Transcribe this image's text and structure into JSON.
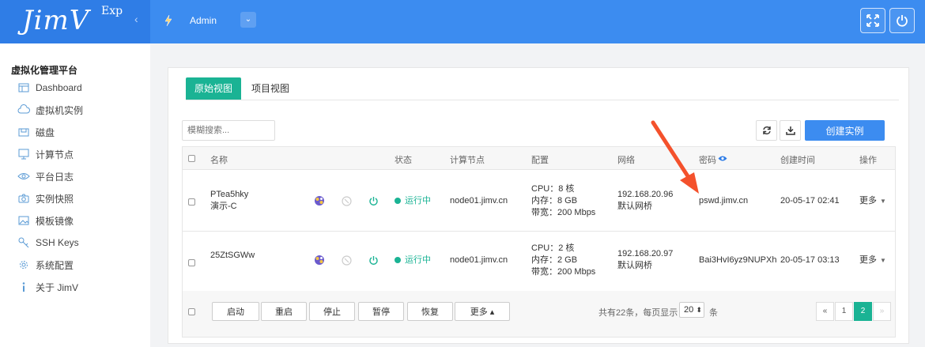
{
  "brand": {
    "logo": "JimV",
    "edition": "Exp",
    "collapse_glyph": "‹"
  },
  "header": {
    "user": "Admin",
    "dropdown_glyph": "⌄",
    "icons": [
      "fullscreen-icon",
      "power-icon"
    ]
  },
  "sidebar": {
    "title": "虚拟化管理平台",
    "items": [
      {
        "label": "Dashboard",
        "icon": "dashboard-icon"
      },
      {
        "label": "虚拟机实例",
        "icon": "cloud-icon"
      },
      {
        "label": "磁盘",
        "icon": "disk-icon"
      },
      {
        "label": "计算节点",
        "icon": "monitor-icon"
      },
      {
        "label": "平台日志",
        "icon": "eye-icon"
      },
      {
        "label": "实例快照",
        "icon": "camera-icon"
      },
      {
        "label": "模板镜像",
        "icon": "image-icon"
      },
      {
        "label": "SSH Keys",
        "icon": "key-icon"
      },
      {
        "label": "系统配置",
        "icon": "gear-icon"
      },
      {
        "label": "关于 JimV",
        "icon": "info-icon"
      }
    ]
  },
  "tabs": [
    {
      "label": "原始视图",
      "active": true
    },
    {
      "label": "项目视图",
      "active": false
    }
  ],
  "toolbar": {
    "search_placeholder": "模糊搜索...",
    "create_label": "创建实例"
  },
  "table": {
    "headers": {
      "name": "名称",
      "status": "状态",
      "node": "计算节点",
      "config": "配置",
      "network": "网络",
      "password": "密码",
      "created": "创建时间",
      "actions": "操作"
    },
    "rows": [
      {
        "name": "PTea5hky",
        "remark": "演示-C",
        "status": "运行中",
        "node": "node01.jimv.cn",
        "cpu": "CPU：8 核",
        "mem": "内存：8 GB",
        "bw": "带宽：200 Mbps",
        "ip": "192.168.20.96",
        "bridge": "默认网桥",
        "password": "pswd.jimv.cn",
        "created": "20-05-17 02:41",
        "more": "更多"
      },
      {
        "name": "25ZtSGWw",
        "remark": "",
        "status": "运行中",
        "node": "node01.jimv.cn",
        "cpu": "CPU：2 核",
        "mem": "内存：2 GB",
        "bw": "带宽：200 Mbps",
        "ip": "192.168.20.97",
        "bridge": "默认网桥",
        "password": "Bai3HvI6yz9NUPXh",
        "created": "20-05-17 03:13",
        "more": "更多"
      }
    ]
  },
  "footer": {
    "buttons": {
      "start": "启动",
      "restart": "重启",
      "stop": "停止",
      "pause": "暂停",
      "resume": "恢复",
      "more": "更多 ▴"
    },
    "total_text": "共有22条，每页显示：",
    "page_size": "20",
    "page_size_caret": "⬍",
    "unit": "条",
    "pages": {
      "prev": "«",
      "p1": "1",
      "p2": "2",
      "next": "»"
    }
  },
  "colors": {
    "header": "#3c8cf0",
    "brand": "#2f7de6",
    "accent": "#1ab394",
    "annotation_arrow": "#f4512c"
  }
}
